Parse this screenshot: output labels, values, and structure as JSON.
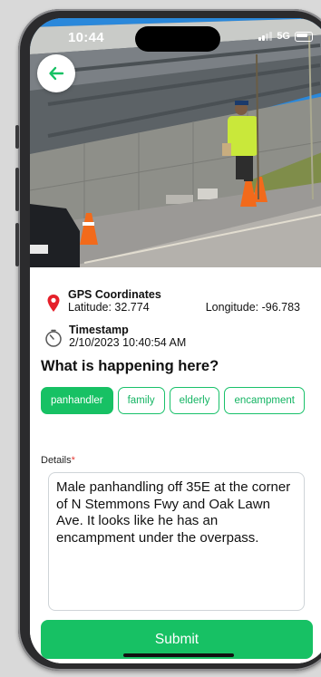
{
  "status_bar": {
    "time": "10:44",
    "network": "5G"
  },
  "location": {
    "title": "GPS Coordinates",
    "latitude": "Latitude: 32.774",
    "longitude": "Longitude: -96.783"
  },
  "timestamp": {
    "title": "Timestamp",
    "value": "2/10/2023 10:40:54 AM"
  },
  "question": "What is happening here?",
  "tags": [
    {
      "label": "panhandler",
      "selected": true
    },
    {
      "label": "family",
      "selected": false
    },
    {
      "label": "elderly",
      "selected": false
    },
    {
      "label": "encampment",
      "selected": false
    }
  ],
  "details": {
    "label": "Details",
    "required_mark": "*",
    "text": "Male panhandling off 35E at the corner of N Stemmons Fwy and Oak Lawn Ave. It looks like he has an encampment under the overpass."
  },
  "submit_label": "Submit",
  "colors": {
    "accent": "#17c164",
    "pin": "#e5202a",
    "required": "#e53935"
  }
}
